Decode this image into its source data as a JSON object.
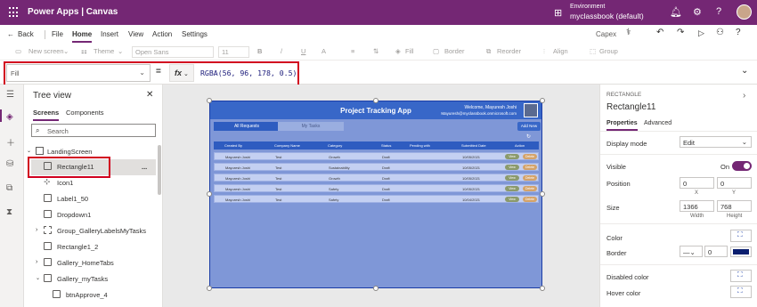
{
  "titlebar": {
    "app_name": "Power Apps  |  Canvas",
    "env_label": "Environment",
    "env_name": "myclassbook (default)"
  },
  "commandbar": {
    "back": "Back",
    "file": "File",
    "home": "Home",
    "insert": "Insert",
    "view": "View",
    "action": "Action",
    "settings": "Settings",
    "user_short": "Capex"
  },
  "toolbar": {
    "new_screen": "New screen",
    "theme": "Theme",
    "font": "Open Sans",
    "font_size": "11",
    "bold": "B",
    "italic": "/",
    "underline": "U",
    "font_color": "A",
    "fill": "Fill",
    "border": "Border",
    "reorder": "Reorder",
    "align": "Align",
    "group": "Group"
  },
  "formulabar": {
    "property": "Fill",
    "eq": "=",
    "fx": "fx",
    "formula": "RGBA(56, 96, 178, 0.5)"
  },
  "tree": {
    "title": "Tree view",
    "tabs": [
      "Screens",
      "Components"
    ],
    "search_placeholder": "Search",
    "items": [
      {
        "label": "LandingScreen"
      },
      {
        "label": "Rectangle11"
      },
      {
        "label": "Icon1"
      },
      {
        "label": "Label1_50"
      },
      {
        "label": "Dropdown1"
      },
      {
        "label": "Group_GalleryLabelsMyTasks"
      },
      {
        "label": "Rectangle1_2"
      },
      {
        "label": "Gallery_HomeTabs"
      },
      {
        "label": "Gallery_myTasks"
      },
      {
        "label": "btnApprove_4"
      }
    ],
    "more": "..."
  },
  "app": {
    "title": "Project Tracking App",
    "welcome": "Welcome, Mayuresh Joshi",
    "email": "Mayuresh@myclassbook.onmicrosoft.com",
    "tab_all": "All Requests",
    "tab_my": "My Tasks",
    "add_new": "Add New",
    "columns": [
      "Created By",
      "Company Name",
      "Category",
      "Status",
      "Pending with",
      "Submitted Date",
      "Action"
    ],
    "rows": [
      [
        "Mayuresh Joshi",
        "Test",
        "Growth",
        "Draft",
        "",
        "10/05/2021"
      ],
      [
        "Mayuresh Joshi",
        "Test",
        "Sustainability",
        "Draft",
        "",
        "10/05/2021"
      ],
      [
        "Mayuresh Joshi",
        "Test",
        "Growth",
        "Draft",
        "",
        "10/05/2021"
      ],
      [
        "Mayuresh Joshi",
        "Test",
        "Safety",
        "Draft",
        "",
        "10/05/2021"
      ],
      [
        "Mayuresh Joshi",
        "Test",
        "Safety",
        "Draft",
        "",
        "10/04/2021"
      ]
    ],
    "view_label": "View",
    "delete_label": "Delete",
    "colors": {
      "header": "#3867c8",
      "overlay": "#7f97d7",
      "row": "#c4d0f2",
      "view_pill": "#8b9a6c",
      "delete_pill": "#d4a36a"
    }
  },
  "rpanel": {
    "type": "RECTANGLE",
    "name": "Rectangle11",
    "tabs": [
      "Properties",
      "Advanced"
    ],
    "display_mode_label": "Display mode",
    "display_mode_value": "Edit",
    "visible_label": "Visible",
    "visible_value": "On",
    "position_label": "Position",
    "x": "0",
    "y": "0",
    "x_label": "X",
    "y_label": "Y",
    "size_label": "Size",
    "width": "1366",
    "height": "768",
    "width_label": "Width",
    "height_label": "Height",
    "color_label": "Color",
    "border_label": "Border",
    "border_width": "0",
    "disabled_color_label": "Disabled color",
    "hover_color_label": "Hover color",
    "border_color": "#0a1e6e"
  }
}
